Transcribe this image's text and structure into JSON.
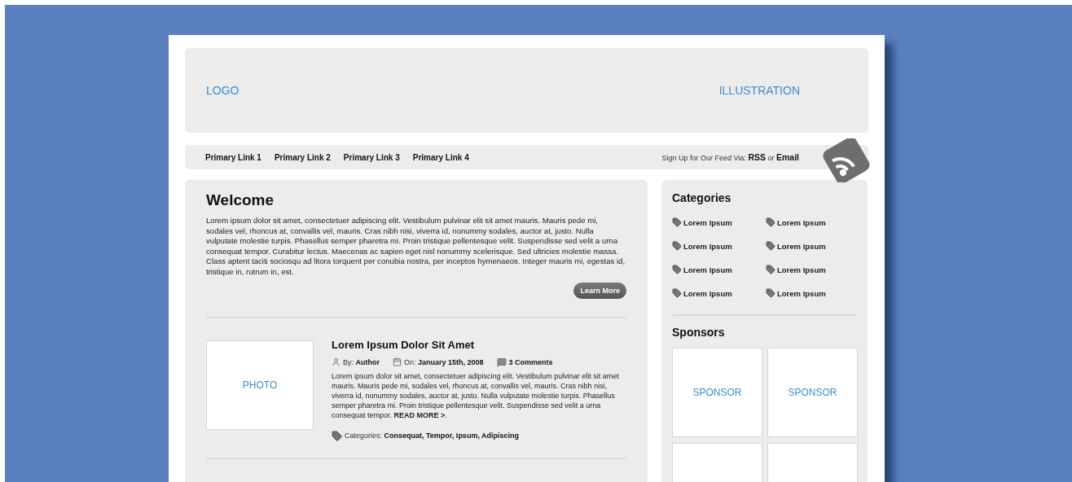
{
  "header": {
    "logo": "LOGO",
    "illustration": "ILLUSTRATION"
  },
  "nav": {
    "links": [
      {
        "label": "Primary Link 1"
      },
      {
        "label": "Primary Link 2"
      },
      {
        "label": "Primary Link 3"
      },
      {
        "label": "Primary Link 4"
      }
    ],
    "feed": "Sign Up for Our Feed Via: **RSS** or **Email**"
  },
  "welcome": {
    "title": "Welcome",
    "text": "Lorem ipsum dolor sit amet, consectetuer adipiscing elit. Vestibulum pulvinar elit sit amet mauris. Mauris pede mi, sodales vel, rhoncus at, convallis vel, mauris. Cras nibh nisi, viverra id, nonummy sodales, auctor at, justo. Nulla vulputate molestie turpis. Phasellus semper pharetra mi. Proin tristique pellentesque velit. Suspendisse sed velit a urna consequat tempor. Curabitur lectus. Maecenas ac sapien eget nisl nonummy scelerisque. Sed ultricies molestie massa. Class aptent taciti sociosqu ad litora torquent per conubia nostra, per inceptos hymenaeos. Integer mauris mi, egestas id, tristique in, rutrum in, est.",
    "button": "Learn More"
  },
  "post": {
    "photo": "PHOTO",
    "title": "Lorem Ipsum Dolor Sit Amet",
    "author": "By: **Author**",
    "date": "On: **January 15th, 2008**",
    "comments": "3 Comments",
    "text": "Lorem ipsum dolor sit amet, consectetuer adipiscing elit. Vestibulum pulvinar elit sit amet mauris. Mauris pede mi, sodales vel, rhoncus at, convallis vel, mauris. Cras nibh nisi, viverra id, nonummy sodales, auctor at, justo. Nulla vulputate molestie turpis. Phasellus semper pharetra mi. Proin tristique pellentesque velit. Suspendisse sed velit a urna consequat tempor. **READ MORE >**.",
    "categories": "Categories: **Consequat, Tempor, Ipsum, Adipiscing**"
  },
  "sidebar": {
    "categories_title": "Categories",
    "categories": [
      {
        "label": "Lorem Ipsum"
      },
      {
        "label": "Lorem Ipsum"
      },
      {
        "label": "Lorem Ipsum"
      },
      {
        "label": "Lorem Ipsum"
      },
      {
        "label": "Lorem Ipsum"
      },
      {
        "label": "Lorem Ipsum"
      },
      {
        "label": "Lorem Ipsum"
      },
      {
        "label": "Lorem Ipsum"
      }
    ],
    "sponsors_title": "Sponsors",
    "sponsors": [
      {
        "kind": "labeled",
        "label": "SPONSOR"
      },
      {
        "kind": "labeled",
        "label": "SPONSOR"
      },
      {
        "kind": "blank"
      },
      {
        "kind": "blank"
      }
    ]
  }
}
